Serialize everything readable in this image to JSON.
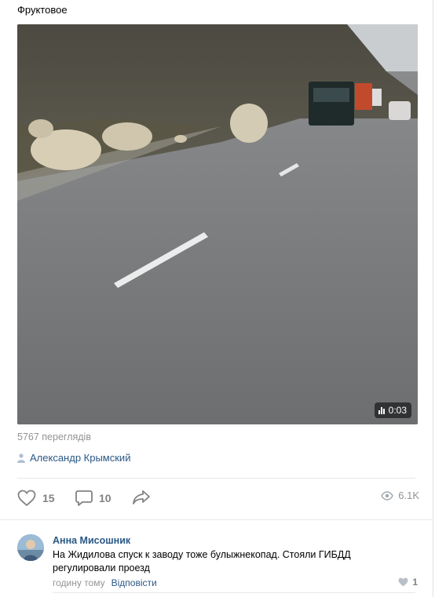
{
  "post": {
    "text": "Фруктовое",
    "video_duration": "0:03",
    "views_label": "5767 переглядів",
    "author": "Александр Крымский"
  },
  "actions": {
    "likes": "15",
    "comments": "10",
    "views": "6.1K",
    "icons": [
      "heart-icon",
      "comment-icon",
      "share-icon",
      "eye-icon"
    ]
  },
  "comment": {
    "author": "Анна Мисошник",
    "text": "На Жидилова спуск к заводу тоже булыжнекопад. Стояли ГИБДД регулировали проезд",
    "time": "годину тому",
    "reply_label": "Відповісти",
    "likes": "1"
  },
  "colors": {
    "link": "#2a5885",
    "muted": "#939393",
    "icon": "#828282"
  }
}
